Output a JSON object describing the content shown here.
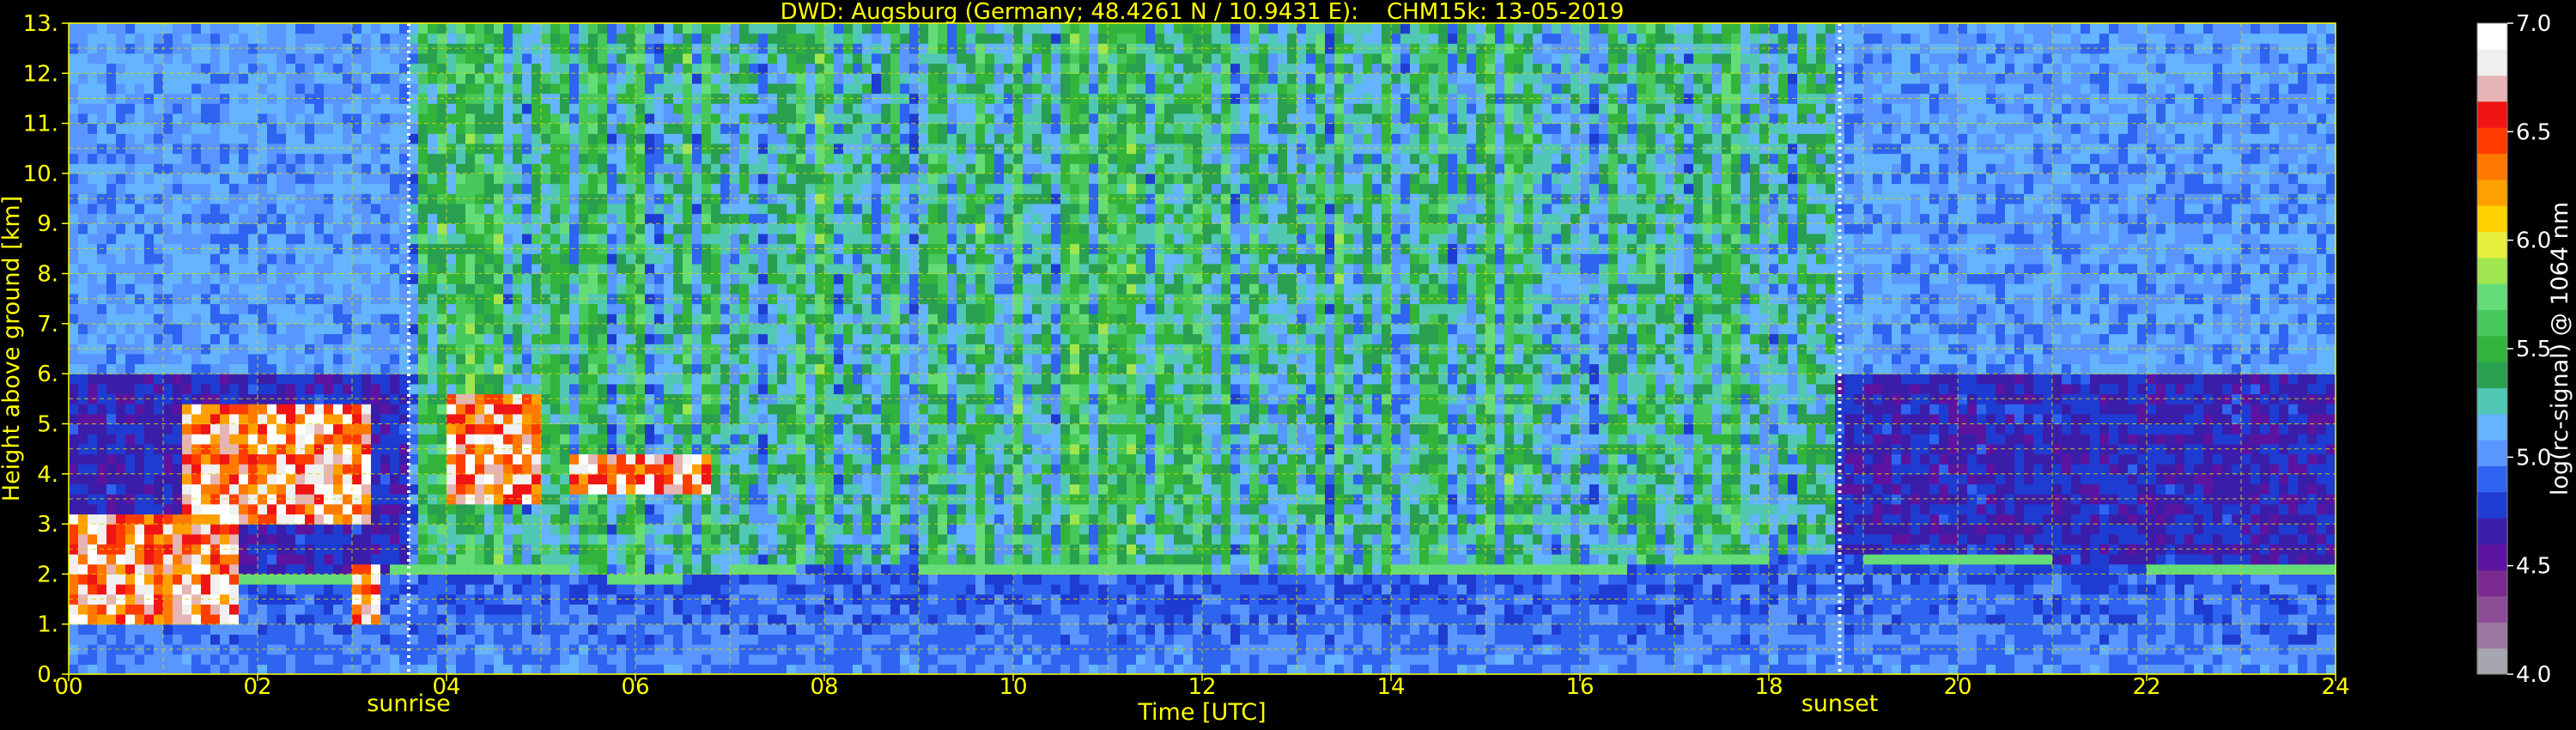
{
  "chart_data": {
    "type": "heatmap",
    "title": "DWD: Augsburg (Germany; 48.4261 N / 10.9431 E):    CHM15k: 13-05-2019",
    "xlabel": "Time [UTC]",
    "ylabel": "Height above ground [km]",
    "xlim": [
      0,
      24
    ],
    "ylim": [
      0,
      13
    ],
    "x_ticks": [
      "00",
      "02",
      "04",
      "06",
      "08",
      "10",
      "12",
      "14",
      "16",
      "18",
      "20",
      "22",
      "24"
    ],
    "y_ticks": [
      "0.",
      "1.",
      "2.",
      "3.",
      "4.",
      "5.",
      "6.",
      "7.",
      "8.",
      "9.",
      "10.",
      "11.",
      "12.",
      "13."
    ],
    "grid": true,
    "annotations": [
      {
        "label": "sunrise",
        "time": 3.6
      },
      {
        "label": "sunset",
        "time": 18.75
      }
    ],
    "colorbar": {
      "label": "log(rc-signal) @ 1064 nm",
      "range": [
        4.0,
        7.0
      ],
      "ticks": [
        "4.0",
        "4.5",
        "5.0",
        "5.5",
        "6.0",
        "6.5",
        "7.0"
      ],
      "colors": [
        "#a6a6b0",
        "#9a78a0",
        "#8c4c96",
        "#7b2a90",
        "#5c14a0",
        "#3a1eaa",
        "#1e3cd2",
        "#2e64f0",
        "#5a96ff",
        "#64b4ff",
        "#50c8b4",
        "#28a050",
        "#32b43c",
        "#46c85a",
        "#64dc78",
        "#a0e650",
        "#e6f03c",
        "#ffd200",
        "#ffa000",
        "#ff7800",
        "#ff3c00",
        "#f01414",
        "#e6b4b4",
        "#f0f0f0",
        "#ffffff"
      ]
    },
    "features": {
      "boundary_layer_top_km": [
        {
          "time": 0.0,
          "height": 2.1
        },
        {
          "time": 3.0,
          "height": 2.0
        },
        {
          "time": 3.6,
          "height": 2.15
        },
        {
          "time": 5.0,
          "height": 2.15
        },
        {
          "time": 6.0,
          "height": 2.0
        },
        {
          "time": 7.0,
          "height": 2.1
        },
        {
          "time": 8.0,
          "height": 2.3
        },
        {
          "time": 10.0,
          "height": 2.2
        },
        {
          "time": 12.0,
          "height": 2.1
        },
        {
          "time": 14.0,
          "height": 2.1
        },
        {
          "time": 16.0,
          "height": 2.2
        },
        {
          "time": 17.0,
          "height": 2.3
        },
        {
          "time": 18.0,
          "height": 2.45
        },
        {
          "time": 19.0,
          "height": 2.45
        },
        {
          "time": 20.0,
          "height": 2.35
        },
        {
          "time": 22.0,
          "height": 2.25
        },
        {
          "time": 24.0,
          "height": 2.2
        }
      ],
      "cloud_layers": [
        {
          "t_start": 0.0,
          "t_end": 1.8,
          "h_bottom": 1.0,
          "h_top": 3.2
        },
        {
          "t_start": 1.2,
          "t_end": 3.2,
          "h_bottom": 3.0,
          "h_top": 5.3
        },
        {
          "t_start": 3.0,
          "t_end": 3.3,
          "h_bottom": 1.0,
          "h_top": 2.2
        },
        {
          "t_start": 4.0,
          "t_end": 5.0,
          "h_bottom": 3.5,
          "h_top": 5.5
        },
        {
          "t_start": 5.3,
          "t_end": 6.8,
          "h_bottom": 3.6,
          "h_top": 4.3
        }
      ]
    }
  }
}
